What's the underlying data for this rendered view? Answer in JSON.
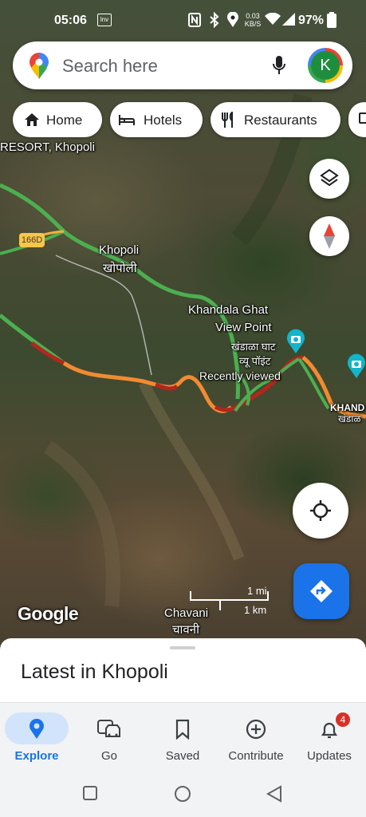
{
  "status_bar": {
    "time": "05:06",
    "net_speed": "0.03 KB/S",
    "battery": "97%"
  },
  "search": {
    "placeholder": "Search here",
    "avatar_letter": "K"
  },
  "chips": [
    {
      "label": "Home",
      "icon": "home-icon"
    },
    {
      "label": "Hotels",
      "icon": "bed-icon"
    },
    {
      "label": "Restaurants",
      "icon": "fork-knife-icon"
    }
  ],
  "map": {
    "labels": {
      "resort": "RESORT, Khopoli",
      "highway": "166D",
      "khopoli_en": "Khopoli",
      "khopoli_mr": "खोपोली",
      "khandala_en_1": "Khandala Ghat",
      "khandala_en_2": "View Point",
      "khandala_mr_1": "खंडाळा घाट",
      "khandala_mr_2": "व्यू पॉइंट",
      "recently_viewed": "Recently viewed",
      "khand": "KHAND",
      "khand_mr": "खंडाळ",
      "chavani_en": "Chavani",
      "chavani_mr": "चावनी"
    },
    "scale": {
      "mi": "1 mi",
      "km": "1 km"
    },
    "attribution": "Google"
  },
  "sheet": {
    "title": "Latest in Khopoli"
  },
  "nav": [
    {
      "label": "Explore",
      "icon": "explore-pin-icon",
      "active": true
    },
    {
      "label": "Go",
      "icon": "car-icon"
    },
    {
      "label": "Saved",
      "icon": "bookmark-icon"
    },
    {
      "label": "Contribute",
      "icon": "add-circle-icon"
    },
    {
      "label": "Updates",
      "icon": "bell-icon",
      "badge": "4"
    }
  ],
  "colors": {
    "accent": "#1a73e8",
    "traffic_green": "#4caf50",
    "traffic_orange": "#f28b30",
    "traffic_red": "#b3261e"
  }
}
